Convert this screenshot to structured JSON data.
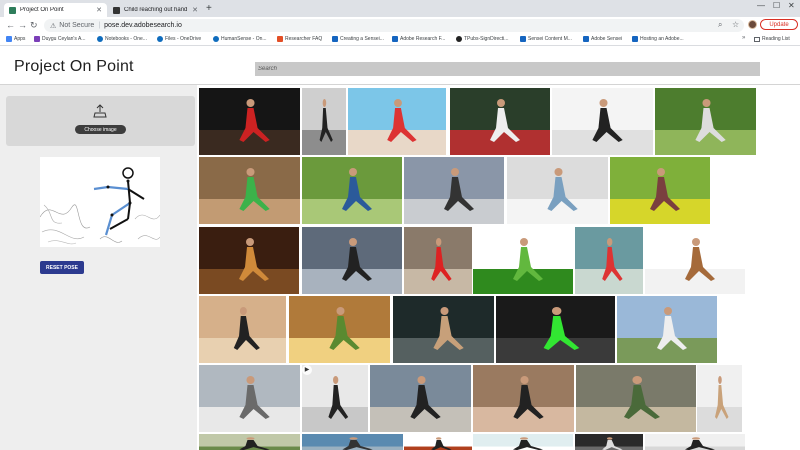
{
  "browser": {
    "tabs": [
      {
        "title": "Project On Point",
        "active": true,
        "favicon_color": "#2e7d5b"
      },
      {
        "title": "Child reaching out hand stock",
        "active": false,
        "favicon_color": "#333333"
      }
    ],
    "url_security": "Not Secure",
    "url": "pose.dev.adobesearch.io",
    "update_label": "Update",
    "bookmarks": [
      {
        "label": "Apps",
        "icon_color": "#4285f4"
      },
      {
        "label": "Duygu Ceylan's A...",
        "icon_color": "#7b3fb8"
      },
      {
        "label": "Notebooks - One...",
        "icon_color": "#0f6cbd"
      },
      {
        "label": "Files - OneDrive",
        "icon_color": "#0f6cbd"
      },
      {
        "label": "HumanSense - On...",
        "icon_color": "#0f6cbd"
      },
      {
        "label": "Researcher FAQ",
        "icon_color": "#e34f26"
      },
      {
        "label": "Creating a Sensei...",
        "icon_color": "#1565c0"
      },
      {
        "label": "Adobe Research F...",
        "icon_color": "#1565c0"
      },
      {
        "label": "TPubs-SignDirecti...",
        "icon_color": "#222222"
      },
      {
        "label": "Sensei Content M...",
        "icon_color": "#1565c0"
      },
      {
        "label": "Adobe Sensei",
        "icon_color": "#1565c0"
      },
      {
        "label": "Hosting an Adobe...",
        "icon_color": "#1565c0"
      }
    ],
    "reading_list": "Reading List"
  },
  "app": {
    "title": "Project On Point",
    "search_placeholder": "Search",
    "choose_image_label": "Choose image",
    "reset_pose_label": "RESET POSE"
  }
}
